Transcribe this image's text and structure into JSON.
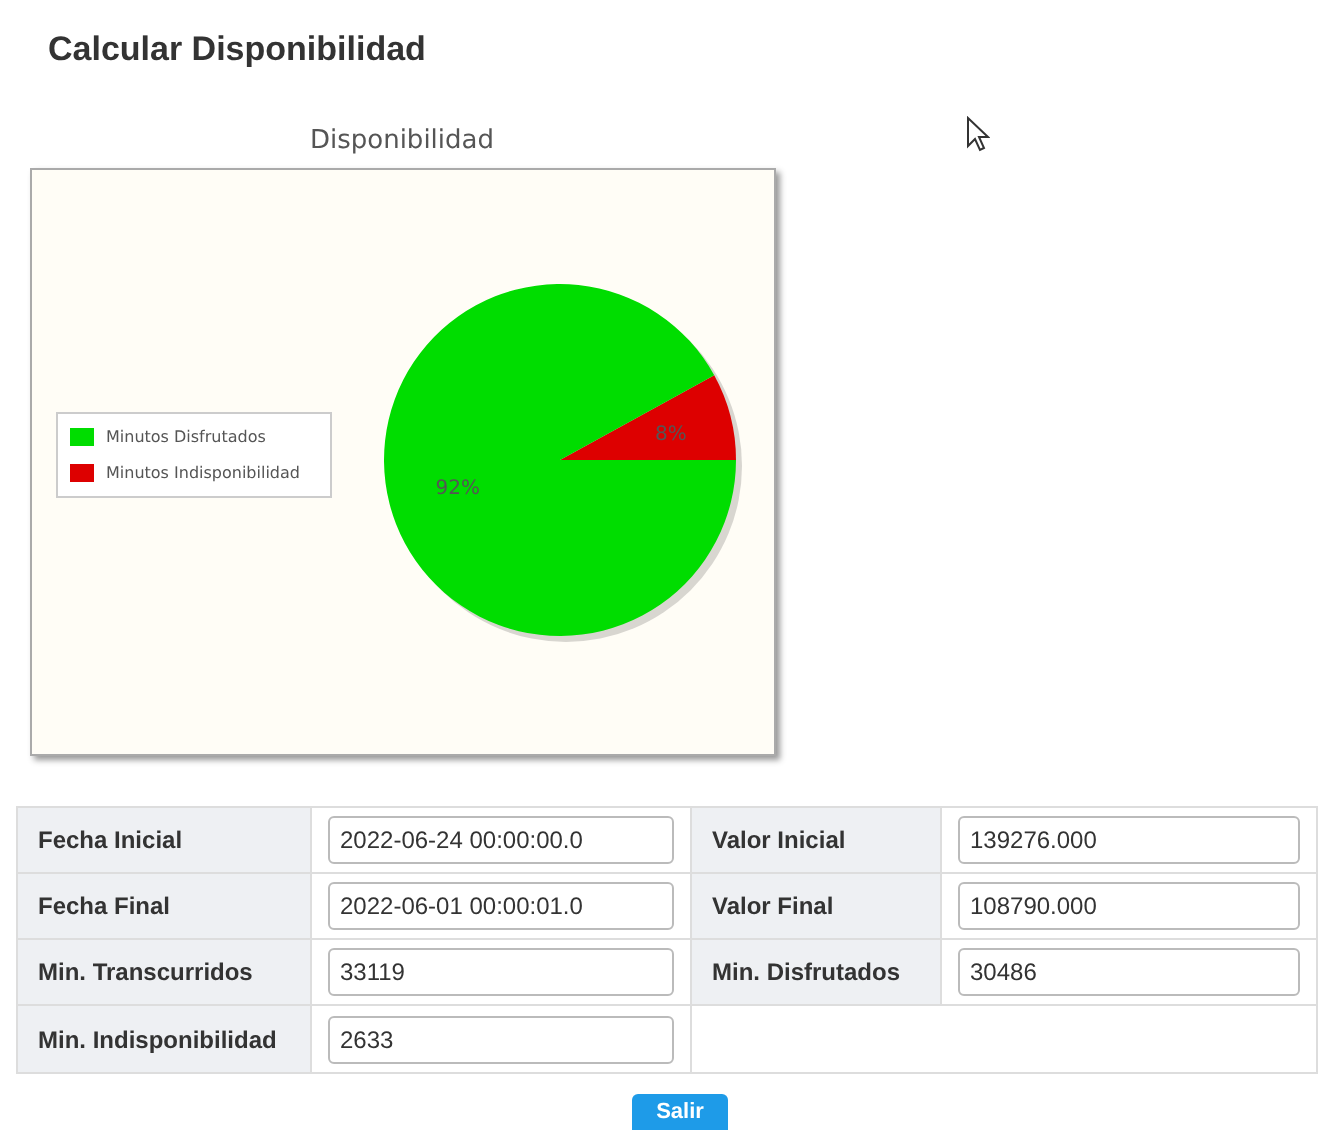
{
  "title": "Calcular Disponibilidad",
  "chart": {
    "chart_data": {
      "type": "pie",
      "title": "Disponibilidad",
      "categories": [
        "Minutos Disfrutados",
        "Minutos Indisponibilidad"
      ],
      "series": [
        {
          "colors": [
            "#00dd00",
            "#dd0000"
          ],
          "values": [
            92,
            8
          ]
        }
      ],
      "value_labels": [
        "92%",
        "8%"
      ]
    }
  },
  "fields": [
    {
      "label": "Fecha Inicial",
      "value": "2022-06-24 00:00:00.0"
    },
    {
      "label": "Valor Inicial",
      "value": "139276.000"
    },
    {
      "label": "Fecha Final",
      "value": "2022-06-01 00:00:01.0"
    },
    {
      "label": "Valor Final",
      "value": "108790.000"
    },
    {
      "label": "Min. Transcurridos",
      "value": "33119"
    },
    {
      "label": "Min. Disfrutados",
      "value": "30486"
    },
    {
      "label": "Min. Indisponibilidad",
      "value": "2633"
    }
  ],
  "button": "Salir"
}
